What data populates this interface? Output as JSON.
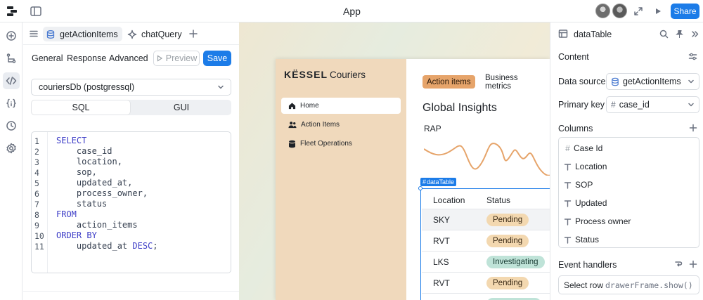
{
  "topbar": {
    "app_title": "App",
    "share_label": "Share",
    "colors": {
      "share_bg": "#1c7ce8"
    }
  },
  "rail": {
    "icons": [
      "add-icon",
      "branch-icon",
      "code-icon",
      "variables-icon",
      "history-icon",
      "settings-icon"
    ]
  },
  "code_panel": {
    "tabs": [
      {
        "label": "getActionItems",
        "active": true,
        "icon": "database-icon"
      },
      {
        "label": "chatQuery",
        "active": false,
        "icon": "sparkle-icon"
      }
    ],
    "subtabs": [
      "General",
      "Response",
      "Advanced"
    ],
    "preview_label": "Preview",
    "save_label": "Save",
    "resource": "couriersDb (postgressql)",
    "modes": [
      {
        "label": "SQL",
        "active": true
      },
      {
        "label": "GUI",
        "active": false
      }
    ],
    "code_lines": [
      {
        "n": "1",
        "text": "SELECT"
      },
      {
        "n": "2",
        "text": "    case_id"
      },
      {
        "n": "3",
        "text": "    location,"
      },
      {
        "n": "4",
        "text": "    sop,"
      },
      {
        "n": "5",
        "text": "    updated_at,"
      },
      {
        "n": "6",
        "text": "    process_owner,"
      },
      {
        "n": "7",
        "text": "    status"
      },
      {
        "n": "8",
        "text": "FROM"
      },
      {
        "n": "9",
        "text": "    action_items"
      },
      {
        "n": "10",
        "text": "ORDER BY"
      },
      {
        "n": "11",
        "text": "    updated_at DESC;"
      }
    ]
  },
  "canvas": {
    "brand_logo": "KËSSEL",
    "brand_name": "Couriers",
    "nav": [
      {
        "label": "Home",
        "active": true,
        "icon": "home-icon"
      },
      {
        "label": "Action Items",
        "active": false,
        "icon": "people-icon"
      },
      {
        "label": "Fleet Operations",
        "active": false,
        "icon": "database-icon"
      }
    ],
    "top_tabs": [
      {
        "label": "Action items",
        "active": true
      },
      {
        "label": "Business metrics",
        "active": false
      }
    ],
    "heading": "Global Insights",
    "chart_label": "RAP",
    "selection_tag": "dataTable",
    "table_headers": [
      "Location",
      "Status"
    ],
    "rows": [
      {
        "location": "SKY",
        "status": "Pending"
      },
      {
        "location": "RVT",
        "status": "Pending"
      },
      {
        "location": "LKS",
        "status": "Investigating"
      },
      {
        "location": "RVT",
        "status": "Pending"
      }
    ]
  },
  "inspector": {
    "title": "dataTable",
    "content_label": "Content",
    "data_source_label": "Data source",
    "data_source_value": "getActionItems",
    "primary_key_label": "Primary key",
    "primary_key_value": "case_id",
    "columns_label": "Columns",
    "columns": [
      {
        "label": "Case Id",
        "icon": "hash-icon"
      },
      {
        "label": "Location",
        "icon": "text-icon"
      },
      {
        "label": "SOP",
        "icon": "text-icon"
      },
      {
        "label": "Updated",
        "icon": "text-icon"
      },
      {
        "label": "Process owner",
        "icon": "text-icon"
      },
      {
        "label": "Status",
        "icon": "text-icon"
      }
    ],
    "event_handlers_label": "Event handlers",
    "event_name": "Select row",
    "event_code": "drawerFrame.show()"
  }
}
